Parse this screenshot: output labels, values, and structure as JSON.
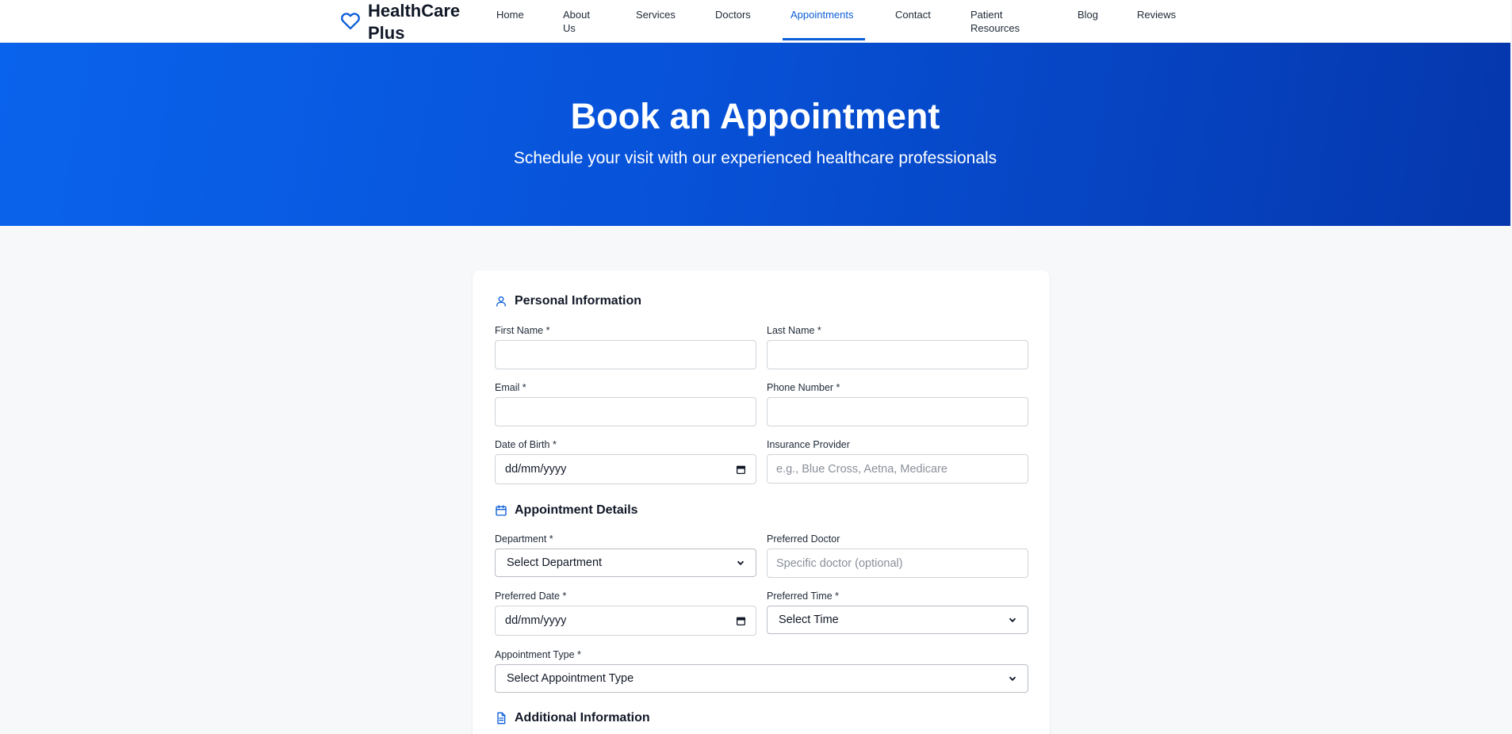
{
  "nav": {
    "brand": "HealthCare Plus",
    "items": [
      "Home",
      "About Us",
      "Services",
      "Doctors",
      "Appointments",
      "Contact",
      "Patient Resources",
      "Blog",
      "Reviews"
    ],
    "active": "Appointments",
    "accent": "#0b5ed7"
  },
  "hero": {
    "title": "Book an Appointment",
    "subtitle": "Schedule your visit with our experienced healthcare professionals"
  },
  "form": {
    "personal": {
      "title": "Personal Information",
      "first_name_label": "First Name *",
      "first_name_value": "",
      "last_name_label": "Last Name *",
      "last_name_value": "",
      "email_label": "Email *",
      "email_value": "",
      "phone_label": "Phone Number *",
      "phone_value": "",
      "dob_label": "Date of Birth *",
      "dob_value": "dd/mm/yyyy",
      "insurance_label": "Insurance Provider",
      "insurance_placeholder": "e.g., Blue Cross, Aetna, Medicare"
    },
    "appointment": {
      "title": "Appointment Details",
      "department_label": "Department *",
      "department_value": "Select Department",
      "doctor_label": "Preferred Doctor",
      "doctor_placeholder": "Specific doctor (optional)",
      "date_label": "Preferred Date *",
      "date_value": "dd/mm/yyyy",
      "time_label": "Preferred Time *",
      "time_value": "Select Time",
      "type_label": "Appointment Type *",
      "type_value": "Select Appointment Type"
    },
    "additional": {
      "title": "Additional Information"
    }
  }
}
